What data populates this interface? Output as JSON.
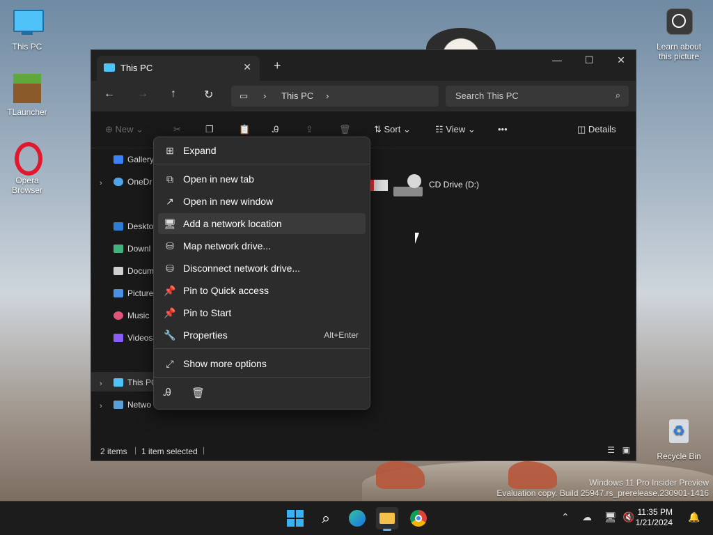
{
  "desktop": {
    "icons": [
      {
        "label": "This PC"
      },
      {
        "label": "TLauncher"
      },
      {
        "label": "Opera Browser"
      },
      {
        "label": "Recycle Bin"
      },
      {
        "label": "Learn about this picture"
      }
    ],
    "watermark": {
      "line1": "Windows 11 Pro Insider Preview",
      "line2": "Evaluation copy. Build 25947.rs_prerelease.230901-1416"
    }
  },
  "window": {
    "tab_title": "This PC",
    "close_tab": "✕",
    "new_tab": "+",
    "controls": {
      "minimize": "—",
      "maximize": "☐",
      "close": "✕"
    },
    "address": {
      "segment": "This PC",
      "sep": "›"
    },
    "search": {
      "placeholder": "Search This PC"
    },
    "toolbar": {
      "new": "New",
      "sort": "Sort",
      "view": "View",
      "more": "•••",
      "details": "Details"
    },
    "sidebar": [
      {
        "label": "Gallery",
        "color": "#3b82f6"
      },
      {
        "label": "OneDr",
        "color": "#4fa3e6"
      },
      {
        "label": "Deskto",
        "color": "#2d7dd2"
      },
      {
        "label": "Downl",
        "color": "#3fb27f"
      },
      {
        "label": "Docum",
        "color": "#cfcfcf"
      },
      {
        "label": "Picture",
        "color": "#4a90e2"
      },
      {
        "label": "Music",
        "color": "#e0557a"
      },
      {
        "label": "Videos",
        "color": "#8a5cf6"
      },
      {
        "label": "This PC",
        "color": "#4fc3f7"
      },
      {
        "label": "Netwo",
        "color": "#5aa0d8"
      }
    ],
    "content": {
      "drive_label": "CD Drive (D:)"
    },
    "status": {
      "items": "2 items",
      "selected": "1 item selected"
    }
  },
  "context_menu": {
    "items": [
      {
        "label": "Expand",
        "icon": "⊞"
      },
      {
        "label": "Open in new tab",
        "icon": "⧉"
      },
      {
        "label": "Open in new window",
        "icon": "↗"
      },
      {
        "label": "Add a network location",
        "icon": "🖥"
      },
      {
        "label": "Map network drive...",
        "icon": "⛁"
      },
      {
        "label": "Disconnect network drive...",
        "icon": "⛁"
      },
      {
        "label": "Pin to Quick access",
        "icon": "📌"
      },
      {
        "label": "Pin to Start",
        "icon": "📌"
      },
      {
        "label": "Properties",
        "icon": "🔧",
        "shortcut": "Alt+Enter"
      },
      {
        "label": "Show more options",
        "icon": "⤢"
      }
    ]
  },
  "taskbar": {
    "time": "11:35 PM",
    "date": "1/21/2024"
  }
}
